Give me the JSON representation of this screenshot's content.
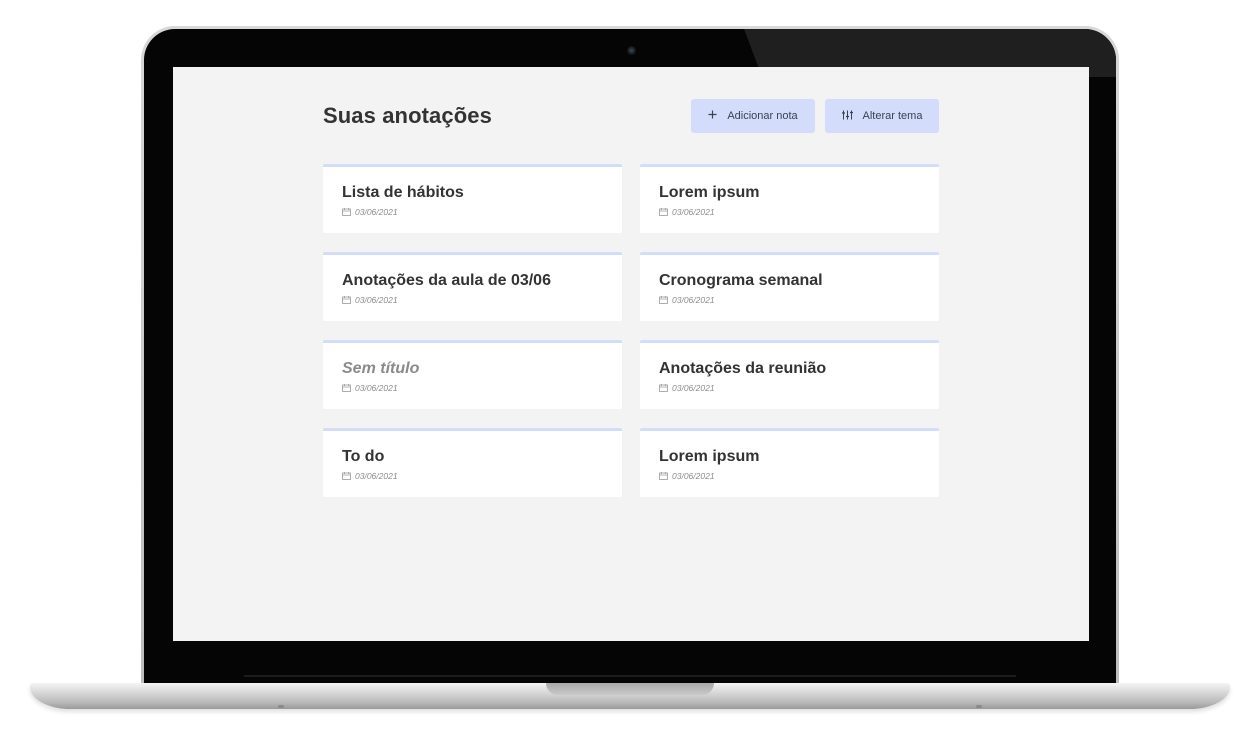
{
  "header": {
    "title": "Suas anotações",
    "add_note_label": "Adicionar nota",
    "change_theme_label": "Alterar tema"
  },
  "notes": [
    {
      "title": "Lista de hábitos",
      "date": "03/06/2021",
      "untitled": false
    },
    {
      "title": "Lorem ipsum",
      "date": "03/06/2021",
      "untitled": false
    },
    {
      "title": "Anotações da aula de 03/06",
      "date": "03/06/2021",
      "untitled": false
    },
    {
      "title": "Cronograma semanal",
      "date": "03/06/2021",
      "untitled": false
    },
    {
      "title": "Sem título",
      "date": "03/06/2021",
      "untitled": true
    },
    {
      "title": "Anotações da reunião",
      "date": "03/06/2021",
      "untitled": false
    },
    {
      "title": "To do",
      "date": "03/06/2021",
      "untitled": false
    },
    {
      "title": "Lorem ipsum",
      "date": "03/06/2021",
      "untitled": false
    }
  ],
  "icons": {
    "add": "plus-icon",
    "theme": "sliders-icon",
    "date": "calendar-icon"
  },
  "colors": {
    "background": "#f3f3f3",
    "card": "#ffffff",
    "accent": "#d3dcfb",
    "text": "#333333",
    "muted": "#8c8c8c"
  }
}
